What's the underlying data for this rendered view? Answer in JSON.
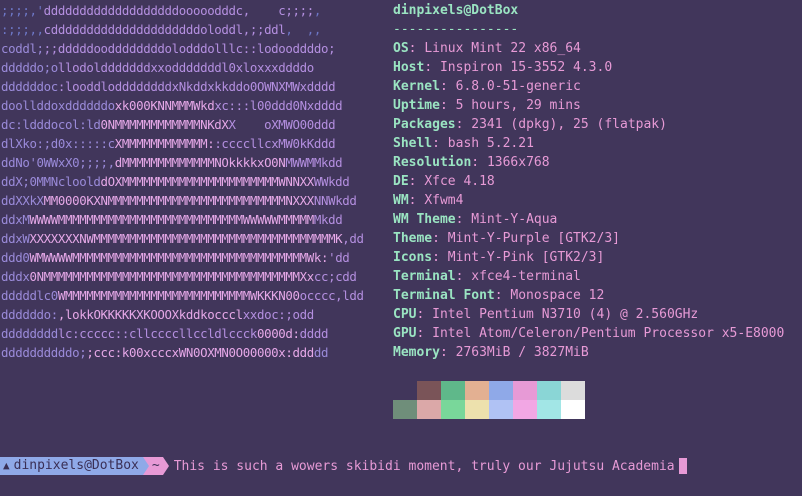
{
  "colors": {
    "background": "#41365b",
    "accent_key": "#9ae4c2",
    "accent_value": "#e79ad6",
    "prompt_user_bg": "#8fa9e8",
    "prompt_dir_bg": "#e79ad6",
    "ascii_palette": {
      "b": "#6e78c8",
      "p": "#9a8ad9",
      "m": "#b48fe0",
      "w": "#e6a8e8",
      "d": "#7c6cb4"
    }
  },
  "ascii_lines": [
    {
      "text": ";;;;,'dddddddddddddddddddooooodddc,    c;;;;,",
      "runs": [
        [
          "b",
          6
        ],
        [
          "m",
          38
        ],
        [
          "b",
          6
        ]
      ]
    },
    {
      "text": ":;;;,,cdddddddddddddddddddddoloddl,;;ddl,  ,,",
      "runs": [
        [
          "b",
          6
        ],
        [
          "m",
          34
        ],
        [
          "b",
          6
        ]
      ]
    },
    {
      "text": "coddl;;;dddddooddddddddolodddolllc::lodooddddo;",
      "runs": [
        [
          "p",
          6
        ],
        [
          "m",
          42
        ]
      ]
    },
    {
      "text": "dddddo;ollodoldddddddxxodddddddl0xloxxxddddo",
      "runs": [
        [
          "p",
          8
        ],
        [
          "m",
          36
        ]
      ]
    },
    {
      "text": "ddddddoc:looddloddddddddxNkddxkkddo0OWNXMWxdddd",
      "runs": [
        [
          "p",
          8
        ],
        [
          "m",
          40
        ]
      ]
    },
    {
      "text": "doollddoxddddddoxk000KNNMMMWkdxc:::l00ddd0Nxdddd",
      "runs": [
        [
          "p",
          16
        ],
        [
          "w",
          14
        ],
        [
          "m",
          18
        ]
      ]
    },
    {
      "text": "dc:ldddocol:ld0NMMMMMMMMMMMMNKdXX    oXMWO00ddd",
      "runs": [
        [
          "p",
          14
        ],
        [
          "w",
          18
        ],
        [
          "m",
          16
        ]
      ]
    },
    {
      "text": "dlXko:;d0x:::::cXMMMMMMMMMMMM::ccccllcxMW0kKddd",
      "runs": [
        [
          "p",
          16
        ],
        [
          "w",
          14
        ],
        [
          "m",
          18
        ]
      ]
    },
    {
      "text": "ddNo'0WWxX0;;;;,dMMMMMMMMMMMMMNOkkkkxO0NMWWMMkdd",
      "runs": [
        [
          "p",
          16
        ],
        [
          "w",
          24
        ],
        [
          "m",
          10
        ]
      ]
    },
    {
      "text": "ddX;0MMNcloolddOXMMMMMMMMMMMMMMMMMMMMMMWNNXXWWkdd",
      "runs": [
        [
          "p",
          14
        ],
        [
          "w",
          30
        ],
        [
          "m",
          6
        ]
      ]
    },
    {
      "text": "ddXXkXMM0000KXNMMMMMMMMMMMMMMMMMMMMMMMMMNXXXNNWkdd",
      "runs": [
        [
          "p",
          6
        ],
        [
          "w",
          38
        ],
        [
          "m",
          6
        ]
      ]
    },
    {
      "text": "ddxMWWWWMMMMMMMMMMMMMMMMMMMMMMMMMMWWWWWMMMMMMkdd",
      "runs": [
        [
          "p",
          4
        ],
        [
          "w",
          40
        ],
        [
          "m",
          6
        ]
      ]
    },
    {
      "text": "ddxWXXXXXXXNWMMMMMMMMMMMMMMMMMMMMMMMMMMMMMMMMMMK,dd",
      "runs": [
        [
          "p",
          4
        ],
        [
          "w",
          44
        ],
        [
          "m",
          4
        ]
      ]
    },
    {
      "text": "ddd0WMWWWWMMMMMMMMMMMMMMMMMMMMMMMMMMMMMMMMMWk:'dd",
      "runs": [
        [
          "p",
          4
        ],
        [
          "w",
          42
        ],
        [
          "m",
          6
        ]
      ]
    },
    {
      "text": "dddx0NMMMMMMMMMMMMMMMMMMMMMMMMMMMMMMMMMMMMXxcc;cdd",
      "runs": [
        [
          "p",
          4
        ],
        [
          "w",
          40
        ],
        [
          "m",
          8
        ]
      ]
    },
    {
      "text": "dddddlc0WMMMMMMMMMMMMMMMMMMMMMMMMMMWKKKN00occcc,ldd",
      "runs": [
        [
          "p",
          8
        ],
        [
          "w",
          34
        ],
        [
          "m",
          10
        ]
      ]
    },
    {
      "text": "ddddddo:,lokkOKKKKKXKOOOXkddkoccclxxdoc:;odd",
      "runs": [
        [
          "p",
          8
        ],
        [
          "w",
          26
        ],
        [
          "m",
          12
        ]
      ]
    },
    {
      "text": "ddddddddlc:ccccc::cllccccllccldlccck0000d:dddd",
      "runs": [
        [
          "p",
          8
        ],
        [
          "m",
          28
        ],
        [
          "w",
          6
        ],
        [
          "m",
          6
        ]
      ]
    },
    {
      "text": "ddddddddddo;;ccc:k00xcccxWN0OXMN0O00000x:ddddd",
      "runs": [
        [
          "p",
          12
        ],
        [
          "w",
          32
        ],
        [
          "p",
          6
        ]
      ]
    }
  ],
  "info": {
    "title": "dinpixels@DotBox",
    "separator": "----------------",
    "rows": [
      {
        "key": "OS",
        "value": "Linux Mint 22 x86_64"
      },
      {
        "key": "Host",
        "value": "Inspiron 15-3552 4.3.0"
      },
      {
        "key": "Kernel",
        "value": "6.8.0-51-generic"
      },
      {
        "key": "Uptime",
        "value": "5 hours, 29 mins"
      },
      {
        "key": "Packages",
        "value": "2341 (dpkg), 25 (flatpak)"
      },
      {
        "key": "Shell",
        "value": "bash 5.2.21"
      },
      {
        "key": "Resolution",
        "value": "1366x768"
      },
      {
        "key": "DE",
        "value": "Xfce 4.18"
      },
      {
        "key": "WM",
        "value": "Xfwm4"
      },
      {
        "key": "WM Theme",
        "value": "Mint-Y-Aqua"
      },
      {
        "key": "Theme",
        "value": "Mint-Y-Purple [GTK2/3]"
      },
      {
        "key": "Icons",
        "value": "Mint-Y-Pink [GTK2/3]"
      },
      {
        "key": "Terminal",
        "value": "xfce4-terminal"
      },
      {
        "key": "Terminal Font",
        "value": "Monospace 12"
      },
      {
        "key": "CPU",
        "value": "Intel Pentium N3710 (4) @ 2.560GHz"
      },
      {
        "key": "GPU",
        "value": "Intel Atom/Celeron/Pentium Processor x5-E8000"
      },
      {
        "key": "Memory",
        "value": "2763MiB / 3827MiB"
      }
    ]
  },
  "palette": {
    "row1": [
      "#41365b",
      "#7a5458",
      "#5fb88a",
      "#e3b092",
      "#8fa9e8",
      "#e79ad6",
      "#8ad6d6",
      "#dcdcdc"
    ],
    "row2": [
      "#6f8e7a",
      "#dba8a8",
      "#79d79a",
      "#ede1ad",
      "#b0c2f4",
      "#f2a7e4",
      "#a2e6e6",
      "#ffffff"
    ]
  },
  "prompt": {
    "icon": "linux-mint-logo-icon",
    "user_host": "dinpixels@DotBox",
    "dir": "~",
    "command": "This is such a wowers skibidi moment, truly our Jujutsu Academia"
  }
}
